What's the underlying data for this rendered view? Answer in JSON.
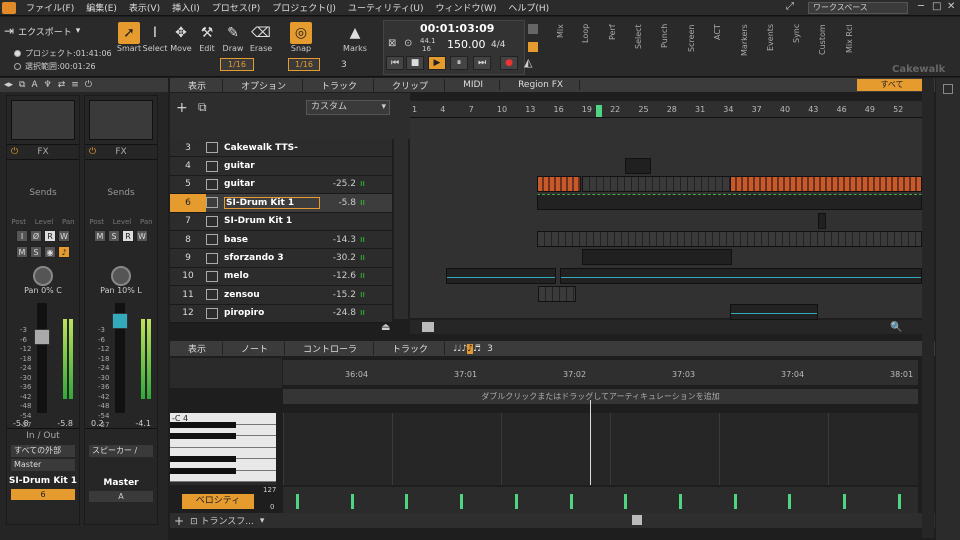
{
  "menu": [
    "ファイル(F)",
    "編集(E)",
    "表示(V)",
    "挿入(I)",
    "プロセス(P)",
    "プロジェクト(J)",
    "ユーティリティ(U)",
    "ウィンドウ(W)",
    "ヘルプ(H)"
  ],
  "workspace": "ワークスペース",
  "toolbar": {
    "export_label": "エクスポート",
    "radio_project": "プロジェクト:01:41:06",
    "radio_selection": "選択範囲:00:01:26",
    "tools": [
      "Smart",
      "Select",
      "Move",
      "Edit",
      "Draw",
      "Erase"
    ],
    "draw_snap": "1/16",
    "snap_label": "Snap",
    "snap_value": "1/16",
    "snap_num": "3",
    "marks_label": "Marks"
  },
  "transport": {
    "time": "00:01:03:09",
    "sample_rate": "44.1",
    "bit_depth": "16",
    "tempo": "150.00",
    "signature": "4/4"
  },
  "modules": [
    "Mix",
    "Loop",
    "Perf",
    "Select",
    "Punch",
    "Screen",
    "ACT",
    "Markers",
    "Events",
    "Sync",
    "Custom",
    "Mix Rcl"
  ],
  "brand": "Cakewalk",
  "track_view": {
    "menus": [
      "表示",
      "オプション",
      "トラック",
      "クリップ",
      "MIDI",
      "Region FX"
    ],
    "all_label": "すべて",
    "preset": "カスタム",
    "ruler": [
      "1",
      "4",
      "7",
      "10",
      "13",
      "16",
      "19",
      "22",
      "25",
      "28",
      "31",
      "34",
      "37",
      "40",
      "43",
      "46",
      "49",
      "52"
    ]
  },
  "tracks": [
    {
      "num": "3",
      "name": "Cakewalk TTS-",
      "vol": "",
      "sel": false
    },
    {
      "num": "4",
      "name": "guitar",
      "vol": "",
      "sel": false
    },
    {
      "num": "5",
      "name": "guitar",
      "vol": "-25.2",
      "sel": false
    },
    {
      "num": "6",
      "name": "SI-Drum Kit 1",
      "vol": "-5.8",
      "sel": true
    },
    {
      "num": "7",
      "name": "SI-Drum Kit 1",
      "vol": "",
      "sel": false
    },
    {
      "num": "8",
      "name": "base",
      "vol": "-14.3",
      "sel": false
    },
    {
      "num": "9",
      "name": "sforzando 3",
      "vol": "-30.2",
      "sel": false
    },
    {
      "num": "10",
      "name": "melo",
      "vol": "-12.6",
      "sel": false
    },
    {
      "num": "11",
      "name": "zensou",
      "vol": "-15.2",
      "sel": false
    },
    {
      "num": "12",
      "name": "piropiro",
      "vol": "-24.8",
      "sel": false
    }
  ],
  "strips": [
    {
      "fx": "FX",
      "sends": "Sends",
      "knob_labels": [
        "Post",
        "Level",
        "Pan"
      ],
      "pan": "Pan 0% C",
      "vol_l": "-5.8",
      "vol_r": "-5.8",
      "io": "In / Out",
      "input": "すべての外部",
      "output": "Master",
      "name": "SI-Drum Kit 1",
      "num": "6"
    },
    {
      "fx": "FX",
      "sends": "Sends",
      "knob_labels": [
        "Post",
        "Level",
        "Pan"
      ],
      "pan": "Pan 10% L",
      "vol_l": "0.2",
      "vol_r": "-4.1",
      "io": "In / Out",
      "input": "スピーカー /",
      "output": "",
      "name": "Master",
      "num": "A"
    }
  ],
  "meter_scale": [
    "-3",
    "-6",
    "-12",
    "-18",
    "-24",
    "-30",
    "-36",
    "-42",
    "-48",
    "-54",
    "-57"
  ],
  "piano_roll": {
    "menus": [
      "表示",
      "ノート",
      "コントローラ",
      "トラック"
    ],
    "snap_num": "3",
    "ruler": [
      "36:04",
      "37:01",
      "37:02",
      "37:03",
      "37:04",
      "38:01"
    ],
    "articulation_hint": "ダブルクリックまたはドラッグしてアーティキュレーションを追加",
    "key_label": "C 4",
    "velocity_label": "ベロシティ",
    "vel_max": "127",
    "vel_min": "0",
    "transform_label": "トランスフ..."
  },
  "colors": {
    "accent": "#e59b2e",
    "velocity": "#4fd482",
    "clip_red": "#c85a2a"
  }
}
